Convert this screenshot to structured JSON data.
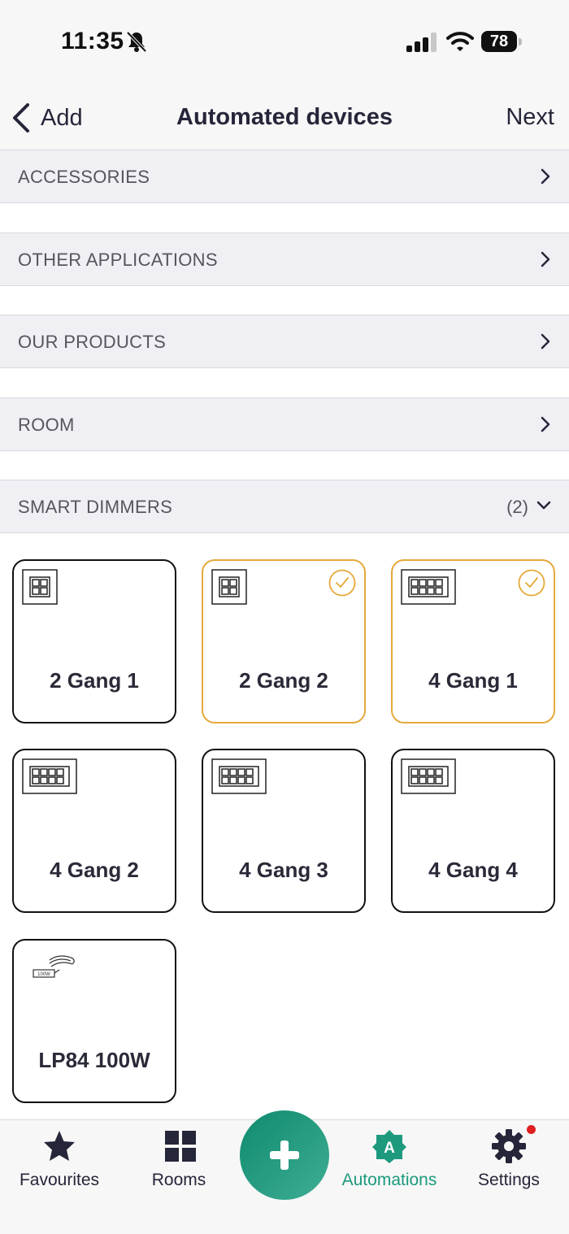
{
  "status_bar": {
    "time": "11:35",
    "battery": "78",
    "icons": [
      "bell-slash-icon",
      "signal-icon",
      "wifi-icon",
      "battery-icon"
    ]
  },
  "nav": {
    "back_label": "Add",
    "title": "Automated devices",
    "next_label": "Next"
  },
  "sections": [
    {
      "title": "ACCESSORIES"
    },
    {
      "title": "OTHER APPLICATIONS"
    },
    {
      "title": "OUR PRODUCTS"
    },
    {
      "title": "ROOM"
    },
    {
      "title": "SMART DIMMERS",
      "count": "(2)"
    }
  ],
  "devices": [
    {
      "label": "2 Gang 1",
      "icon": "two-gang-switch-icon",
      "selected": false
    },
    {
      "label": "2 Gang 2",
      "icon": "two-gang-switch-icon",
      "selected": true
    },
    {
      "label": "4 Gang 1",
      "icon": "four-gang-switch-icon",
      "selected": true
    },
    {
      "label": "4 Gang 2",
      "icon": "four-gang-switch-icon",
      "selected": false
    },
    {
      "label": "4 Gang 3",
      "icon": "four-gang-switch-icon",
      "selected": false
    },
    {
      "label": "4 Gang 4",
      "icon": "four-gang-switch-icon",
      "selected": false
    },
    {
      "label": "LP84 100W",
      "icon": "led-strip-driver-icon",
      "selected": false
    },
    {
      "led_driver_text": "100W"
    }
  ],
  "tabs": [
    {
      "label": "Favourites",
      "icon": "star-icon"
    },
    {
      "label": "Rooms",
      "icon": "grid-icon"
    },
    {
      "label": "Automations",
      "icon": "automations-icon",
      "badge_letter": "A"
    },
    {
      "label": "Settings",
      "icon": "gear-icon"
    }
  ],
  "colors": {
    "selected_border": "#e5a93a",
    "accent": "#1d9a7e",
    "fab_gradient_start": "#0f8a6e",
    "fab_gradient_end": "#3fae93",
    "notification_dot": "#e02020",
    "section_background": "#efeff4"
  }
}
